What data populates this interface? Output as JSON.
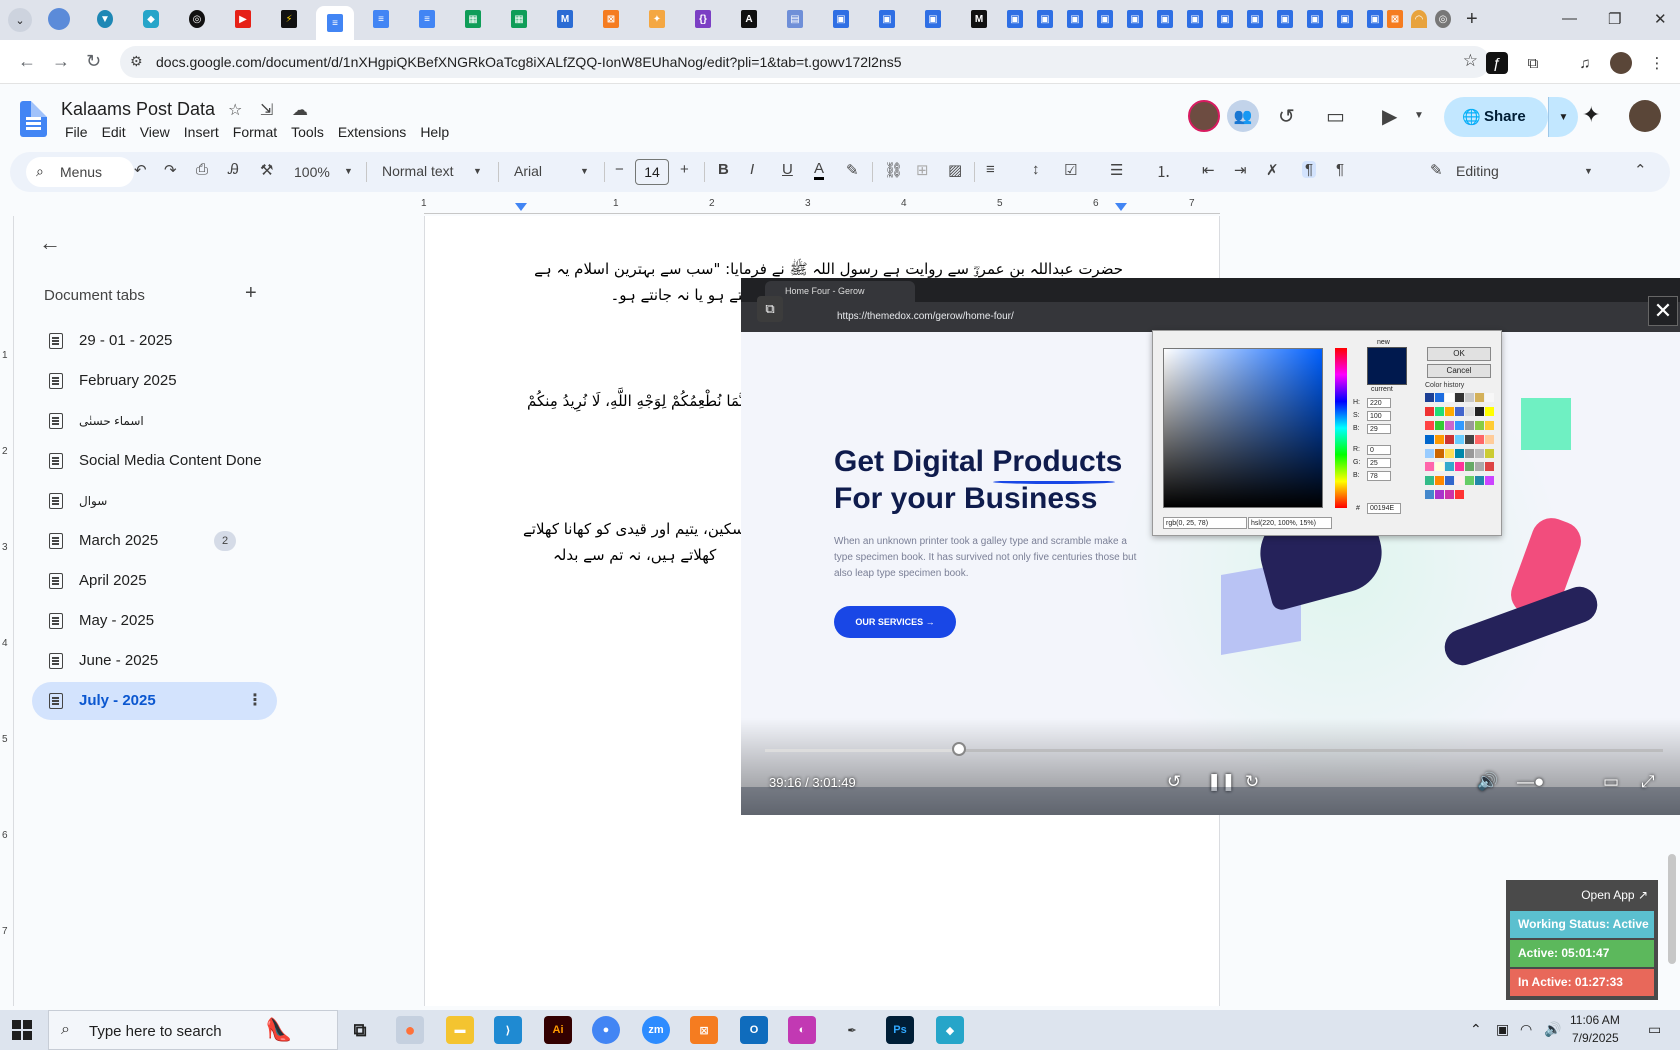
{
  "browser": {
    "url": "docs.google.com/document/d/1nXHgpiQKBefXNGRkOaTcg8iXALfZQQ-IonW8EUhaNog/edit?pli=1&tab=t.gowv172l2ns5"
  },
  "doc": {
    "title": "Kalaams Post Data",
    "menu": [
      "File",
      "Edit",
      "View",
      "Insert",
      "Format",
      "Tools",
      "Extensions",
      "Help"
    ],
    "share_label": "Share"
  },
  "toolbar": {
    "menus_label": "Menus",
    "zoom": "100%",
    "style": "Normal text",
    "font": "Arial",
    "font_size": "14",
    "mode": "Editing"
  },
  "ruler": {
    "numbers": [
      "1",
      "1",
      "2",
      "3",
      "4",
      "5",
      "6",
      "7"
    ],
    "vertical_numbers": [
      "1",
      "2",
      "3",
      "4",
      "5",
      "6",
      "7"
    ]
  },
  "sidebar": {
    "header": "Document tabs",
    "tabs": [
      {
        "label": "29 - 01 - 2025"
      },
      {
        "label": "February 2025"
      },
      {
        "label": "اسماء حسنٰی"
      },
      {
        "label": "Social Media Content Done"
      },
      {
        "label": "سوال"
      },
      {
        "label": "March 2025",
        "badge": "2"
      },
      {
        "label": "April 2025"
      },
      {
        "label": "May - 2025"
      },
      {
        "label": "June - 2025"
      },
      {
        "label": "July - 2025",
        "selected": true
      }
    ]
  },
  "page": {
    "lines": [
      "حضرت عبداللہ بن عمروؓ سے روایت ہے رسول اللہ ﷺ نے فرمایا: \"سب سے بہترین اسلام یہ ہے",
      "کہ تم کھانا کھلاؤ اور سلام کرو ہر اس شخص کو جسے تم جانتے ہو یا نہ جانتے ہو۔",
      "{إِنَّمَا نُطْعِمُكُمْ لِوَجْهِ اللَّهِ، لَا نُرِيدُ مِنكُمْ",
      "مسکین، یتیم اور قیدی کو کھانا کھلاتے",
      "کھلاتے ہیں، نہ تم سے بدلہ"
    ]
  },
  "video": {
    "tab_title": "Home Four - Gerow",
    "url": "https://themedox.com/gerow/home-four/",
    "hero_line1": "Get Digital Products",
    "hero_line2": "For your Business",
    "hero_desc": "When an unknown printer took a galley type and scramble make a type specimen book. It has survived not only five centuries those but also leap type specimen book.",
    "services_btn": "OUR SERVICES",
    "time": "39:16 / 3:01:49",
    "progress": 0.2164,
    "color_picker": {
      "ok": "OK",
      "cancel": "Cancel",
      "history_label": "Color history",
      "h": "220",
      "s": "100",
      "b": "29",
      "r": "0",
      "g": "25",
      "bl": "78",
      "rgb": "rgb(0, 25, 78)",
      "hsl": "hsl(220, 100%, 15%)",
      "hex": "00194E",
      "new_label": "new",
      "current_label": "current"
    }
  },
  "status_widget": {
    "open_app": "Open App",
    "working": "Working Status: Active",
    "active": "Active: 05:01:47",
    "inactive": "In Active: 01:27:33",
    "colors": {
      "working": "#5bc0cf",
      "active": "#5cb85c",
      "inactive": "#e8685a"
    }
  },
  "taskbar": {
    "search_placeholder": "Type here to search",
    "time": "11:06 AM",
    "date": "7/9/2025"
  },
  "colors": {
    "accent": "#0b57d0",
    "share_bg": "#c2e7ff",
    "selected_tab_bg": "#d3e3fd"
  }
}
